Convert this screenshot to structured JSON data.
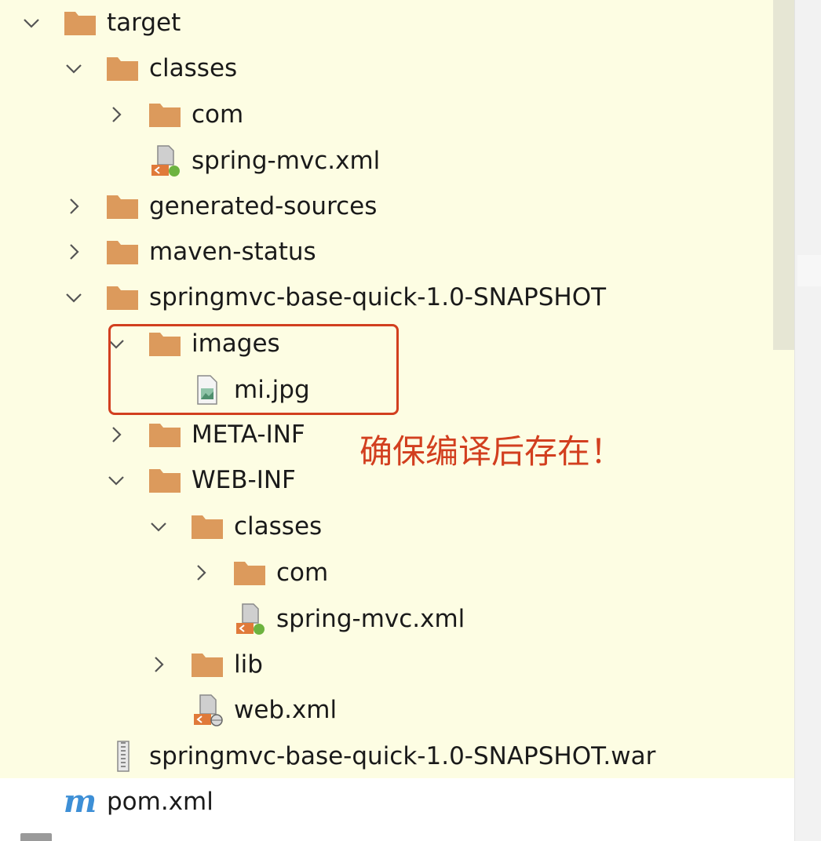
{
  "tree": {
    "rows": [
      {
        "label": "target",
        "type": "folder",
        "arrow": "down"
      },
      {
        "label": "classes",
        "type": "folder",
        "arrow": "down"
      },
      {
        "label": "com",
        "type": "folder",
        "arrow": "right"
      },
      {
        "label": "spring-mvc.xml",
        "type": "spring-xml-icon",
        "arrow": "none"
      },
      {
        "label": "generated-sources",
        "type": "folder",
        "arrow": "right"
      },
      {
        "label": "maven-status",
        "type": "folder",
        "arrow": "right"
      },
      {
        "label": "springmvc-base-quick-1.0-SNAPSHOT",
        "type": "folder",
        "arrow": "down"
      },
      {
        "label": "images",
        "type": "folder",
        "arrow": "down"
      },
      {
        "label": "mi.jpg",
        "type": "image-file-icon",
        "arrow": "none"
      },
      {
        "label": "META-INF",
        "type": "folder",
        "arrow": "right"
      },
      {
        "label": "WEB-INF",
        "type": "folder",
        "arrow": "down"
      },
      {
        "label": "classes",
        "type": "folder",
        "arrow": "down"
      },
      {
        "label": "com",
        "type": "folder",
        "arrow": "right"
      },
      {
        "label": "spring-mvc.xml",
        "type": "spring-xml-icon",
        "arrow": "none"
      },
      {
        "label": "lib",
        "type": "folder",
        "arrow": "right"
      },
      {
        "label": "web.xml",
        "type": "web-xml-icon",
        "arrow": "none"
      },
      {
        "label": "springmvc-base-quick-1.0-SNAPSHOT.war",
        "type": "archive-icon",
        "arrow": "none"
      },
      {
        "label": "pom.xml",
        "type": "maven-icon",
        "arrow": "none"
      }
    ]
  },
  "annotation": {
    "text": "确保编译后存在！"
  },
  "colors": {
    "tree_background": "#fdfde3",
    "folder": "#dc9a5c",
    "annotation": "#d23f1f",
    "maven_icon": "#3d8fd6"
  }
}
